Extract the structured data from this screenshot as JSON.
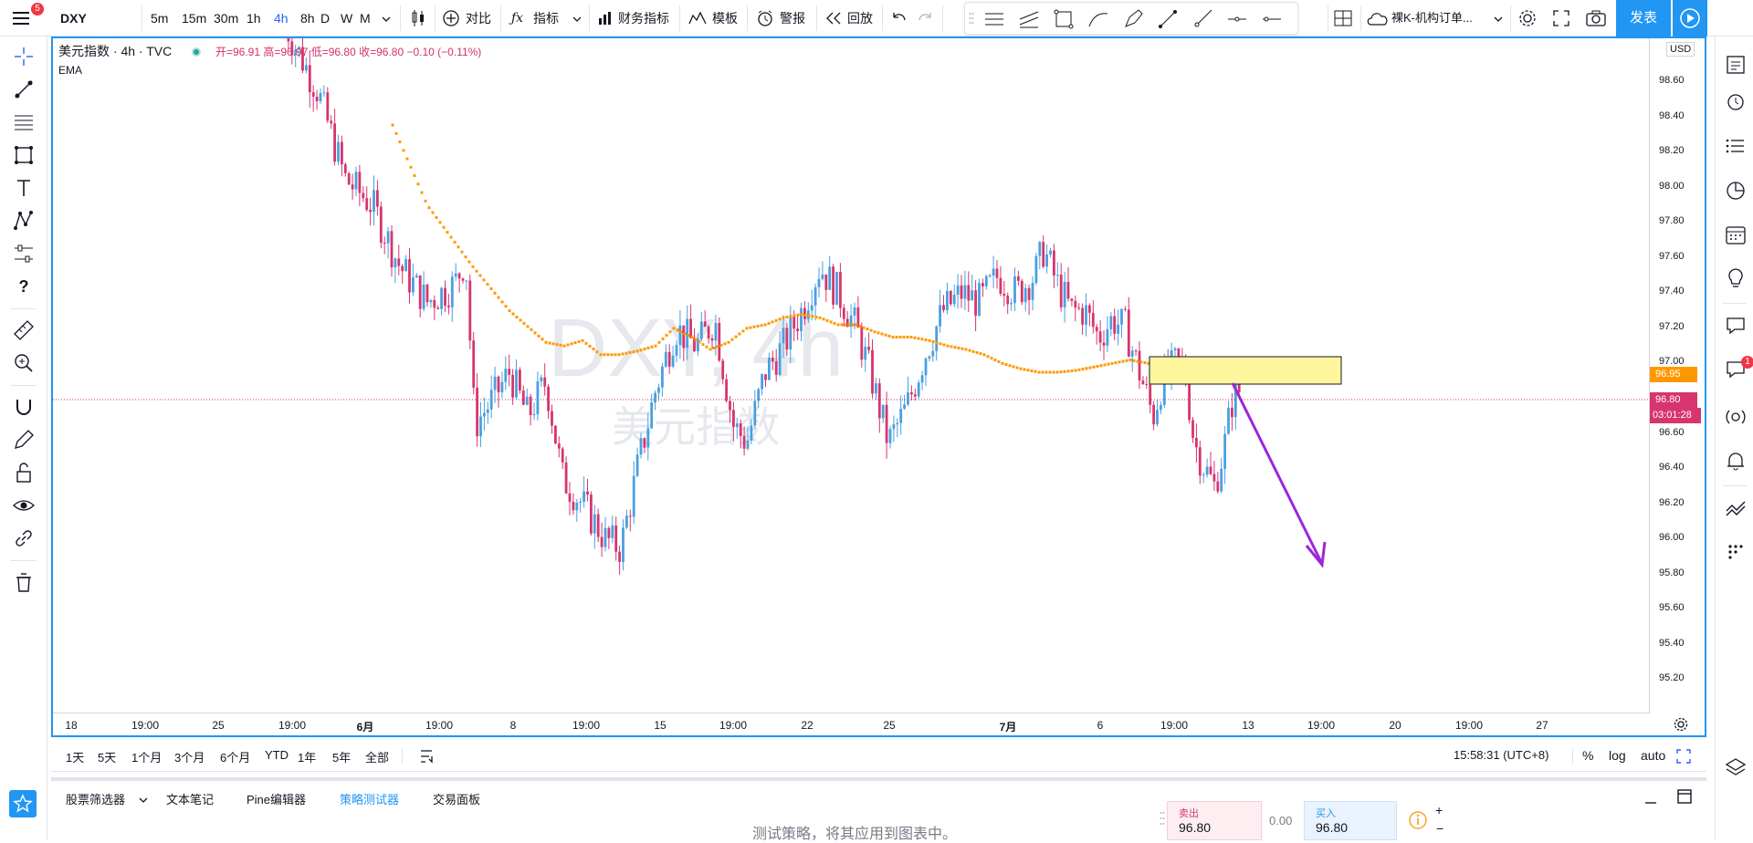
{
  "topbar": {
    "symbol": "DXY",
    "timeframes": [
      "5m",
      "15m",
      "30m",
      "1h",
      "4h",
      "8h",
      "D",
      "W",
      "M"
    ],
    "active_timeframe": "4h",
    "compare_label": "对比",
    "indicators_label": "指标",
    "financials_label": "财务指标",
    "templates_label": "模板",
    "alert_label": "警报",
    "replay_label": "回放",
    "layout_name": "裸K-机构订单...",
    "publish_label": "发表",
    "notification_count": "5"
  },
  "legend": {
    "title": "美元指数 · 4h · TVC",
    "ohlc": "开=96.91 高=96.97 低=96.80 收=96.80 −0.10 (−0.11%)",
    "indicator": "EMA"
  },
  "watermark": {
    "symbol": "DXY, 4h",
    "name": "美元指数"
  },
  "price_scale": {
    "currency": "USD",
    "labels": [
      "98.60",
      "98.40",
      "98.20",
      "98.00",
      "97.80",
      "97.60",
      "97.40",
      "97.20",
      "97.00",
      "96.80",
      "96.60",
      "96.40",
      "96.20",
      "96.00",
      "95.80",
      "95.60",
      "95.40",
      "95.20"
    ],
    "ema_badge": "96.95",
    "price_badge": "96.80",
    "countdown": "03:01:28"
  },
  "time_scale": [
    "18",
    "19:00",
    "25",
    "19:00",
    "6月",
    "19:00",
    "8",
    "19:00",
    "15",
    "19:00",
    "22",
    "25",
    "7月",
    "6",
    "19:00",
    "13",
    "19:00",
    "20",
    "19:00",
    "27"
  ],
  "range_bar": {
    "ranges": [
      "1天",
      "5天",
      "1个月",
      "3个月",
      "6个月",
      "YTD",
      "1年",
      "5年",
      "全部"
    ],
    "clock": "15:58:31 (UTC+8)",
    "percent": "%",
    "log": "log",
    "auto": "auto"
  },
  "bottom_tabs": [
    "股票筛选器",
    "文本笔记",
    "Pine编辑器",
    "策略测试器",
    "交易面板"
  ],
  "active_bottom_tab": "策略测试器",
  "strategy_hint": "测试策略，将其应用到图表中。",
  "trade": {
    "sell_label": "卖出",
    "sell_price": "96.80",
    "spread": "0.00",
    "buy_label": "买入",
    "buy_price": "96.80"
  },
  "colors": {
    "accent": "#2196f3",
    "up": "#4a9fe0",
    "down": "#d6356e",
    "ema": "#ff9800",
    "zone": "#fff176",
    "arrow": "#9c27d8"
  },
  "alerts_badge": "1"
}
